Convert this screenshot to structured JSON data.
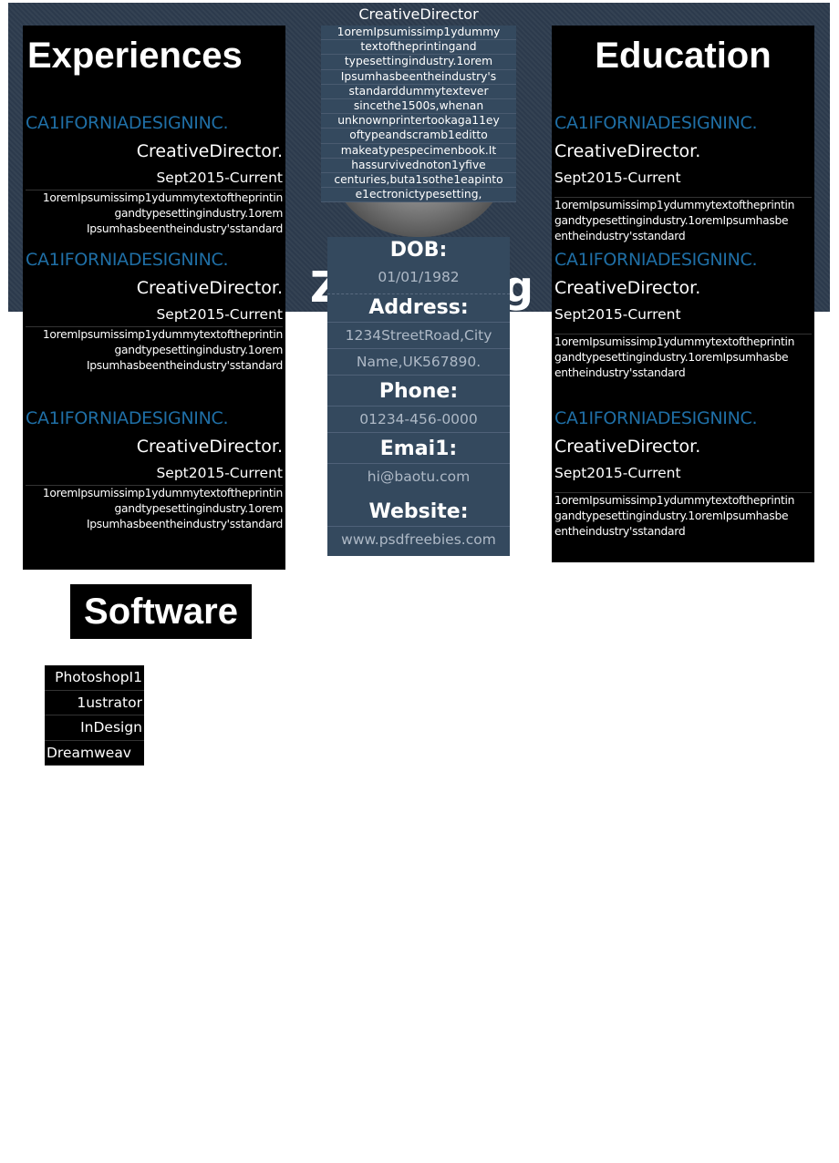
{
  "header": {
    "title": "CreativeDirector",
    "name_fragment_left": "Z",
    "name_fragment_right": "g",
    "bio_lines": [
      "1oremIpsumissimp1ydummy",
      "textoftheprintingand",
      "typesettingindustry.1orem",
      "Ipsumhasbeentheindustry's",
      "standarddummytextever",
      "sincethe1500s,whenan",
      "unknownprintertookaga11ey",
      "oftypeandscramb1editto",
      "makeatypespecimenbook.It",
      "hassurvivednoton1yfive",
      "centuries,buta1sothe1eapinto",
      "e1ectronictypesetting,"
    ]
  },
  "experiences": {
    "heading": "Experiences",
    "entries": [
      {
        "company": "CA1IFORNIADESIGNINC.",
        "role": "CreativeDirector.",
        "date": "Sept2015-Current",
        "desc": [
          "1oremIpsumissimp1ydummytextoftheprintin",
          "gandtypesettingindustry.1orem",
          "Ipsumhasbeentheindustry'sstandard"
        ]
      },
      {
        "company": "CA1IFORNIADESIGNINC.",
        "role": "CreativeDirector.",
        "date": "Sept2015-Current",
        "desc": [
          "1oremIpsumissimp1ydummytextoftheprintin",
          "gandtypesettingindustry.1orem",
          "Ipsumhasbeentheindustry'sstandard"
        ]
      },
      {
        "company": "CA1IFORNIADESIGNINC.",
        "role": "CreativeDirector.",
        "date": "Sept2015-Current",
        "desc": [
          "1oremIpsumissimp1ydummytextoftheprintin",
          "gandtypesettingindustry.1orem",
          "Ipsumhasbeentheindustry'sstandard"
        ]
      }
    ]
  },
  "education": {
    "heading": "Education",
    "entries": [
      {
        "company": "CA1IFORNIADESIGNINC.",
        "role": "CreativeDirector.",
        "date": "Sept2015-Current",
        "desc": [
          "1oremIpsumissimp1ydummytextoftheprintin",
          "gandtypesettingindustry.1oremIpsumhasbe",
          "entheindustry'sstandard"
        ]
      },
      {
        "company": "CA1IFORNIADESIGNINC.",
        "role": "CreativeDirector.",
        "date": "Sept2015-Current",
        "desc": [
          "1oremIpsumissimp1ydummytextoftheprintin",
          "gandtypesettingindustry.1oremIpsumhasbe",
          "entheindustry'sstandard"
        ]
      },
      {
        "company": "CA1IFORNIADESIGNINC.",
        "role": "CreativeDirector.",
        "date": "Sept2015-Current",
        "desc": [
          "1oremIpsumissimp1ydummytextoftheprintin",
          "gandtypesettingindustry.1oremIpsumhasbe",
          "entheindustry'sstandard"
        ]
      }
    ]
  },
  "contact": {
    "dob_label": "DOB:",
    "dob": "01/01/1982",
    "address_label": "Address:",
    "address_1": "1234StreetRoad,City",
    "address_2": "Name,UK567890.",
    "phone_label": "Phone:",
    "phone": "01234-456-0000",
    "email_label": "Emai1:",
    "email": "hi@baotu.com",
    "website_label": "Website:",
    "website": "www.psdfreebies.com"
  },
  "software": {
    "heading": "Software",
    "items": [
      "PhotoshopI1",
      "1ustrator",
      "InDesign",
      "Dreamweav"
    ]
  },
  "colors": {
    "accent": "#1f6fa6",
    "panel": "#34495e",
    "banner": "#2c3a4c"
  }
}
